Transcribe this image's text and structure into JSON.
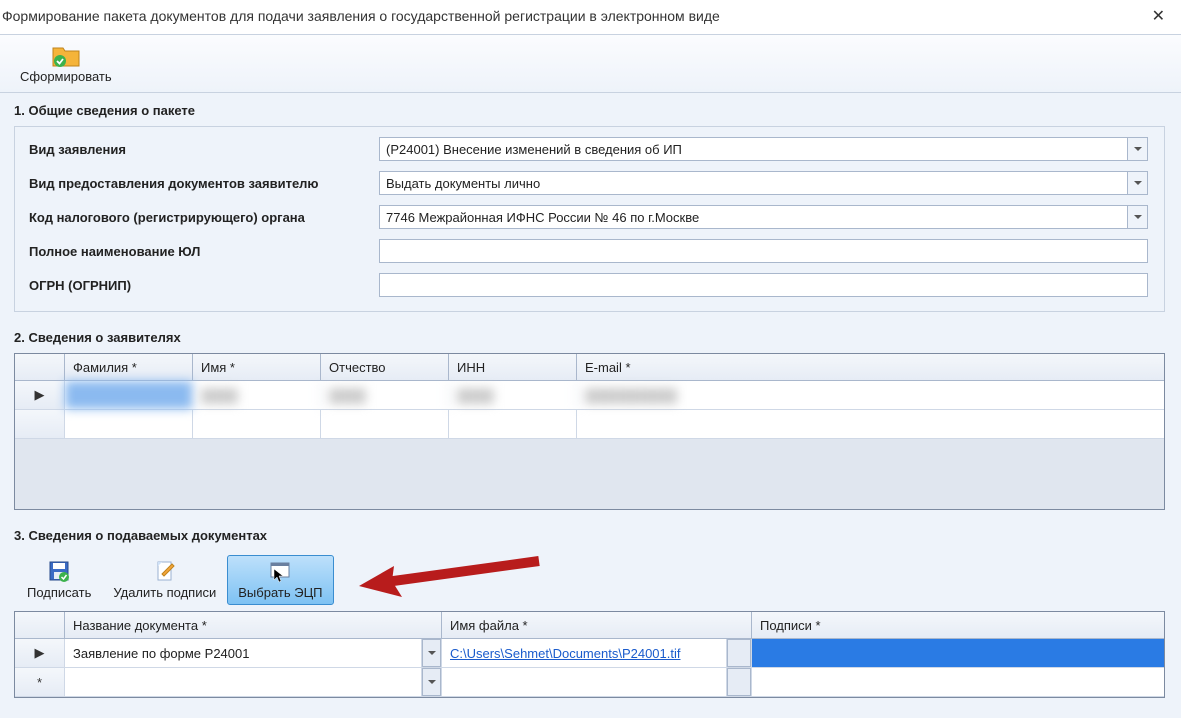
{
  "window": {
    "title": "Формирование пакета документов для подачи заявления о государственной регистрации в электронном виде"
  },
  "toolbar": {
    "form_button": "Сформировать"
  },
  "section1": {
    "title": "1. Общие сведения о пакете",
    "application_type_label": "Вид заявления",
    "application_type_value": "(Р24001) Внесение изменений в сведения об ИП",
    "delivery_method_label": "Вид предоставления документов заявителю",
    "delivery_method_value": "Выдать документы лично",
    "tax_code_label": "Код налогового (регистрирующего) органа",
    "tax_code_value": "7746 Межрайонная ИФНС России № 46 по г.Москве",
    "legal_full_name_label": "Полное наименование ЮЛ",
    "legal_full_name_value": "",
    "ogrn_label": "ОГРН (ОГРНИП)",
    "ogrn_value": ""
  },
  "section2": {
    "title": "2. Сведения о заявителях",
    "headers": {
      "lastname": "Фамилия *",
      "firstname": "Имя *",
      "patronymic": "Отчество",
      "inn": "ИНН",
      "email": "E-mail *"
    },
    "rows": [
      {
        "selector": "▶",
        "lastname": "██████",
        "firstname": "████",
        "patronymic": "████",
        "inn": "████",
        "email": "██████████"
      }
    ]
  },
  "section3": {
    "title": "3. Сведения о подаваемых документах",
    "toolbar": {
      "sign": "Подписать",
      "remove_signs": "Удалить подписи",
      "choose_ecp": "Выбрать ЭЦП"
    },
    "headers": {
      "doc_name": "Название документа *",
      "file_name": "Имя файла *",
      "signatures": "Подписи *"
    },
    "rows": [
      {
        "selector": "▶",
        "doc_name": "Заявление по форме Р24001",
        "file_name": "C:\\Users\\Sehmet\\Documents\\P24001.tif",
        "signatures": ""
      },
      {
        "selector": "*",
        "doc_name": "",
        "file_name": "",
        "signatures": ""
      }
    ]
  }
}
